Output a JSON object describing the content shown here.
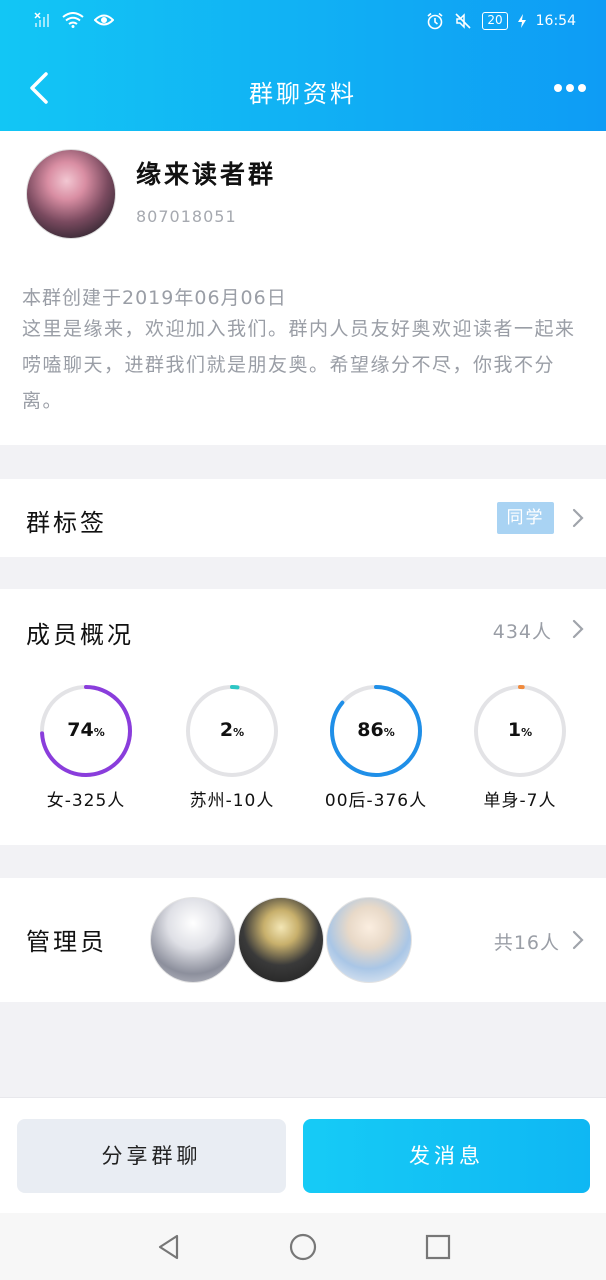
{
  "status_bar": {
    "left_icons": [
      "signal-off-icon",
      "wifi-icon",
      "eye-icon"
    ],
    "right_icons": [
      "alarm-icon",
      "mute-icon"
    ],
    "battery": "20",
    "time": "16:54"
  },
  "nav": {
    "title": "群聊资料"
  },
  "group": {
    "name": "缘来读者群",
    "id": "807018051",
    "created": "本群创建于2019年06月06日",
    "description": "这里是缘来，欢迎加入我们。群内人员友好奥欢迎读者一起来唠嗑聊天，进群我们就是朋友奥。希望缘分不尽，你我不分离。"
  },
  "tags": {
    "label": "群标签",
    "value": "同学"
  },
  "members": {
    "label": "成员概况",
    "count": "434人",
    "stats": [
      {
        "percent_text": "74",
        "unit": "%",
        "label": "女-325人",
        "fraction": 0.74,
        "color": "#8a3ddc"
      },
      {
        "percent_text": "2",
        "unit": "%",
        "label": "苏州-10人",
        "fraction": 0.02,
        "color": "#2dc6c4"
      },
      {
        "percent_text": "86",
        "unit": "%",
        "label": "00后-376人",
        "fraction": 0.86,
        "color": "#1f8fe8"
      },
      {
        "percent_text": "1",
        "unit": "%",
        "label": "单身-7人",
        "fraction": 0.01,
        "color": "#f08a3c"
      }
    ]
  },
  "admins": {
    "label": "管理员",
    "total": "共16人"
  },
  "actions": {
    "share": "分享群聊",
    "send": "发消息"
  },
  "colors": {
    "header_start": "#12c6f5",
    "header_end": "#0e9cf5",
    "accent": "#0fb7f3",
    "tag_bg": "#a9d3f3",
    "muted_text": "#9a9ea6"
  }
}
